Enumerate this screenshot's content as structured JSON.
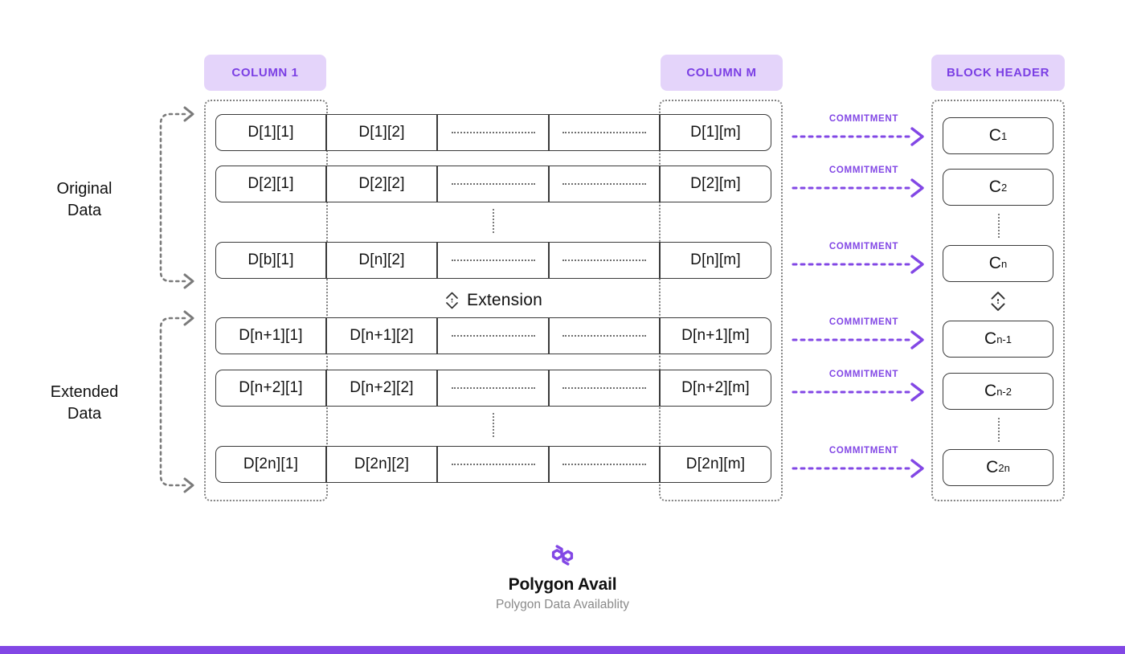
{
  "headers": {
    "column1": "COLUMN 1",
    "columnM": "COLUMN M",
    "blockHeader": "BLOCK HEADER"
  },
  "side_labels": {
    "original": "Original\nData",
    "original_line1": "Original",
    "original_line2": "Data",
    "extended_line1": "Extended",
    "extended_line2": "Data"
  },
  "extension": {
    "label": "Extension",
    "icon": "up-down-chevron-icon"
  },
  "grid": {
    "rows": [
      {
        "id": "row-1",
        "cells": [
          "D[1][1]",
          "D[1][2]",
          "",
          "",
          "D[1][m]"
        ]
      },
      {
        "id": "row-2",
        "cells": [
          "D[2][1]",
          "D[2][2]",
          "",
          "",
          "D[2][m]"
        ]
      },
      {
        "id": "row-n",
        "cells": [
          "D[b][1]",
          "D[n][2]",
          "",
          "",
          "D[n][m]"
        ]
      },
      {
        "id": "row-n1",
        "cells": [
          "D[n+1][1]",
          "D[n+1][2]",
          "",
          "",
          "D[n+1][m]"
        ]
      },
      {
        "id": "row-n2",
        "cells": [
          "D[n+2][1]",
          "D[n+2][2]",
          "",
          "",
          "D[n+2][m]"
        ]
      },
      {
        "id": "row-2n",
        "cells": [
          "D[2n][1]",
          "D[2n][2]",
          "",
          "",
          "D[2n][m]"
        ]
      }
    ]
  },
  "commitments": {
    "label": "COMMITMENT",
    "items": [
      {
        "label": "COMMITMENT"
      },
      {
        "label": "COMMITMENT"
      },
      {
        "label": "COMMITMENT"
      },
      {
        "label": "COMMITMENT"
      },
      {
        "label": "COMMITMENT"
      },
      {
        "label": "COMMITMENT"
      }
    ]
  },
  "block_header": {
    "items": [
      {
        "base": "C",
        "sub": "1"
      },
      {
        "base": "C",
        "sub": "2"
      },
      {
        "base": "C",
        "sub": "n"
      },
      {
        "base": "C",
        "sub": "n-1"
      },
      {
        "base": "C",
        "sub": "n-2"
      },
      {
        "base": "C",
        "sub": "2n"
      }
    ]
  },
  "brand": {
    "title": "Polygon Avail",
    "subtitle": "Polygon Data Availablity",
    "logo": "polygon-logo-icon"
  },
  "colors": {
    "accent_purple": "#8247e5",
    "chip_text": "#7b3fe4",
    "chip_bg": "#e4d4fa",
    "cell_border": "#3a3a3a",
    "dashed_gray": "#808080",
    "footer_bar": "#8247e5",
    "subtitle_gray": "#8a8a8a"
  }
}
